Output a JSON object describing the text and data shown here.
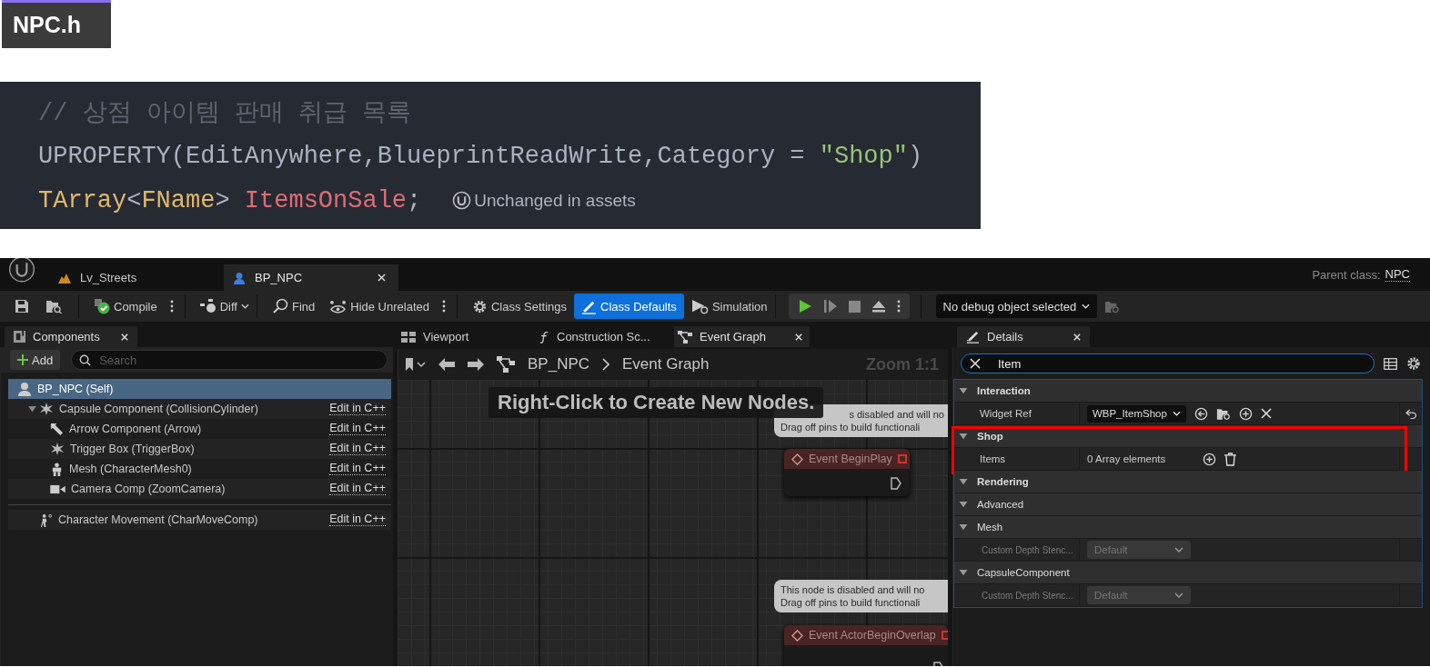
{
  "file_tab": {
    "label": "NPC.h",
    "selected": true
  },
  "code": {
    "lines": [
      [
        {
          "text": "// 상점 아이템 판매 취급 목록",
          "kind": "comment"
        }
      ],
      [
        {
          "text": "UPROPERTY(EditAnywhere,BlueprintReadWrite,Category = ",
          "kind": "plain"
        },
        {
          "text": "\"Shop\"",
          "kind": "string"
        },
        {
          "text": ")",
          "kind": "plain"
        }
      ],
      [
        {
          "text": "TArray",
          "kind": "type"
        },
        {
          "text": "<",
          "kind": "plain"
        },
        {
          "text": "FName",
          "kind": "type"
        },
        {
          "text": "> ",
          "kind": "plain"
        },
        {
          "text": "ItemsOnSale",
          "kind": "field"
        },
        {
          "text": ";",
          "kind": "plain"
        }
      ]
    ],
    "hint": "Unchanged in assets"
  },
  "editor": {
    "doc_tabs": [
      {
        "label": "Lv_Streets",
        "kind": "level",
        "selected": false
      },
      {
        "label": "BP_NPC",
        "kind": "blueprint",
        "selected": true
      }
    ],
    "parent_class": {
      "label": "Parent class:",
      "value": "NPC"
    },
    "toolbar": {
      "compile": "Compile",
      "diff": "Diff",
      "find": "Find",
      "hide_unrelated": "Hide Unrelated",
      "modes": [
        {
          "label": "Class Settings",
          "kind": "settings",
          "selected": false
        },
        {
          "label": "Class Defaults",
          "kind": "defaults",
          "selected": true
        },
        {
          "label": "Simulation",
          "kind": "simulation",
          "selected": false
        }
      ],
      "debug_object": "No debug object selected"
    },
    "components": {
      "tab": "Components",
      "add": "Add",
      "search": {
        "placeholder": "Search"
      },
      "tree": [
        {
          "name": "BP_NPC (Self)",
          "kind": "actor",
          "selected": true,
          "children": [
            {
              "name": "Capsule Component (CollisionCylinder)",
              "kind": "capsule",
              "action": "Edit in C++",
              "selected": false,
              "expanded": true,
              "children": [
                {
                  "name": "Arrow Component (Arrow)",
                  "kind": "arrow",
                  "action": "Edit in C++",
                  "selected": false
                },
                {
                  "name": "Trigger Box (TriggerBox)",
                  "kind": "trigger",
                  "action": "Edit in C++",
                  "selected": false
                },
                {
                  "name": "Mesh (CharacterMesh0)",
                  "kind": "mesh",
                  "action": "Edit in C++",
                  "selected": false
                },
                {
                  "name": "Camera Comp (ZoomCamera)",
                  "kind": "camera",
                  "action": "Edit in C++",
                  "selected": false
                }
              ]
            }
          ]
        }
      ],
      "others": [
        {
          "name": "Character Movement (CharMoveComp)",
          "kind": "movement",
          "action": "Edit in C++",
          "selected": false
        }
      ]
    },
    "graph_tabs": [
      {
        "label": "Viewport",
        "kind": "viewport",
        "selected": false
      },
      {
        "label": "Construction Sc...",
        "kind": "function",
        "selected": false
      },
      {
        "label": "Event Graph",
        "kind": "graph",
        "selected": true
      }
    ],
    "breadcrumb": [
      "BP_NPC",
      "Event Graph"
    ],
    "zoom": "Zoom 1:1",
    "graph_hint": "Right-Click to Create New Nodes.",
    "nodes": [
      {
        "comment": [
          "s disabled and will no",
          "Drag off pins to build functionali"
        ],
        "title": "Event BeginPlay",
        "disabled": true
      },
      {
        "comment": [
          "This node is disabled and will no",
          "Drag off pins to build functionali"
        ],
        "title": "Event ActorBeginOverlap",
        "disabled": true
      }
    ],
    "details": {
      "tab": "Details",
      "search": {
        "value": "Item"
      },
      "categories": [
        {
          "name": "Interaction",
          "expanded": true,
          "highlighted": false,
          "rows": [
            {
              "label": "Widget Ref",
              "kind": "object",
              "value": "WBP_ItemShop",
              "disabled": false
            }
          ]
        },
        {
          "name": "Shop",
          "expanded": true,
          "highlighted": true,
          "rows": [
            {
              "label": "Items",
              "kind": "array",
              "value": "0 Array elements",
              "disabled": false
            }
          ]
        },
        {
          "name": "Rendering",
          "expanded": true,
          "highlighted": false
        },
        {
          "name": "Advanced",
          "expanded": true,
          "highlighted": false
        },
        {
          "name": "Mesh",
          "expanded": true,
          "highlighted": false,
          "rows": [
            {
              "label": "Custom Depth Stenc...",
              "kind": "enum",
              "value": "Default",
              "disabled": true
            }
          ]
        },
        {
          "name": "CapsuleComponent",
          "expanded": true,
          "highlighted": false,
          "rows": [
            {
              "label": "Custom Depth Stenc...",
              "kind": "enum",
              "value": "Default",
              "disabled": true
            }
          ]
        }
      ]
    }
  }
}
